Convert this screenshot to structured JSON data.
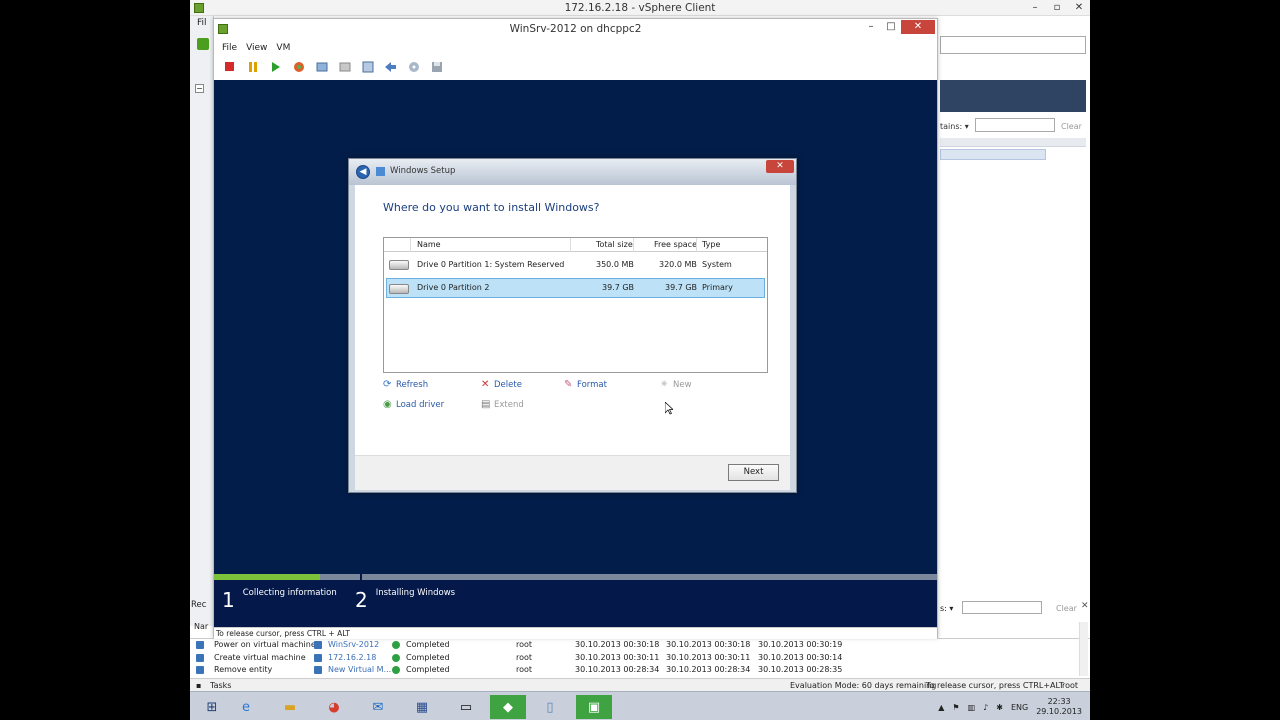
{
  "outer": {
    "title": "172.16.2.18 - vSphere Client",
    "ctrl_min": "–",
    "ctrl_max": "▫",
    "ctrl_close": "✕",
    "left_menu_fragment": "Fil",
    "recent_fragment": "Rec",
    "name_fragment": "Nar",
    "right_contains": "tains: ▾",
    "right_clear": "Clear",
    "right_contains2": "s: ▾",
    "right_clear2": "Clear",
    "right_x": "✕"
  },
  "console": {
    "title": "WinSrv-2012 on dhcppc2",
    "ctrl_min": "–",
    "ctrl_max": "□",
    "ctrl_close": "✕",
    "menu": [
      "File",
      "View",
      "VM"
    ],
    "toolbar_icons": [
      "stop-icon",
      "pause-icon",
      "play-icon",
      "reset-icon",
      "snapshot-icon",
      "revert-icon",
      "manage-snapshots-icon",
      "network-icon",
      "cd-icon",
      "floppy-icon"
    ],
    "status": "To release cursor, press CTRL + ALT",
    "steps": [
      {
        "num": "1",
        "label": "Collecting information"
      },
      {
        "num": "2",
        "label": "Installing Windows"
      }
    ],
    "progress": 0.147
  },
  "dialog": {
    "title": "Windows Setup",
    "heading": "Where do you want to install Windows?",
    "close": "✕",
    "columns": {
      "name": "Name",
      "total": "Total size",
      "free": "Free space",
      "type": "Type"
    },
    "partitions": [
      {
        "name": "Drive 0 Partition 1: System Reserved",
        "total": "350.0 MB",
        "free": "320.0 MB",
        "type": "System"
      },
      {
        "name": "Drive 0 Partition 2",
        "total": "39.7 GB",
        "free": "39.7 GB",
        "type": "Primary"
      }
    ],
    "actions": {
      "refresh": "Refresh",
      "delete": "Delete",
      "format": "Format",
      "new": "New",
      "load_driver": "Load driver",
      "extend": "Extend"
    },
    "next": "Next"
  },
  "tasks": [
    {
      "name": "Power on virtual machine",
      "target": "WinSrv-2012",
      "status": "Completed",
      "by": "root",
      "req": "30.10.2013 00:30:18",
      "start": "30.10.2013 00:30:18",
      "end": "30.10.2013 00:30:19"
    },
    {
      "name": "Create virtual machine",
      "target": "172.16.2.18",
      "status": "Completed",
      "by": "root",
      "req": "30.10.2013 00:30:11",
      "start": "30.10.2013 00:30:11",
      "end": "30.10.2013 00:30:14"
    },
    {
      "name": "Remove entity",
      "target": "New Virtual M...",
      "status": "Completed",
      "by": "root",
      "req": "30.10.2013 00:28:34",
      "start": "30.10.2013 00:28:34",
      "end": "30.10.2013 00:28:35"
    }
  ],
  "statusbar": {
    "tasks": "Tasks",
    "evaluation": "Evaluation Mode: 60 days remaining",
    "release": "To release cursor, press CTRL+ALT",
    "user": "root"
  },
  "taskbar": {
    "apps": [
      "start-icon",
      "ie-icon",
      "explorer-icon",
      "chrome-icon",
      "outlook-icon",
      "vsphere-icon",
      "terminal-icon",
      "app-icon",
      "notepad-icon",
      "vsphere-client-icon"
    ],
    "lang": "ENG",
    "time": "22:33",
    "date": "29.10.2013"
  }
}
